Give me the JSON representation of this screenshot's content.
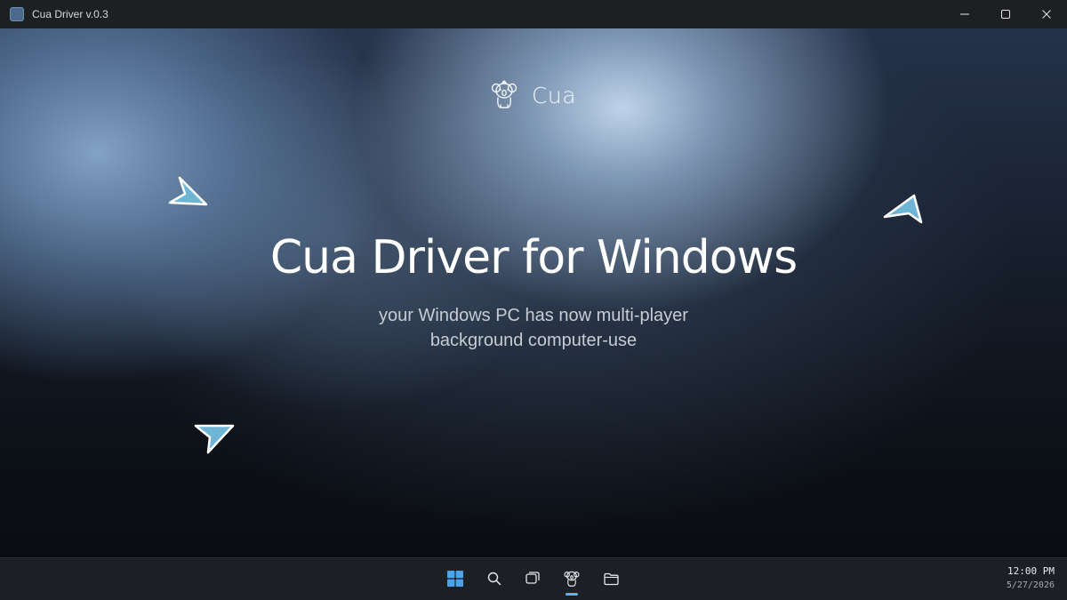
{
  "window": {
    "title": "Cua Driver v.0.3",
    "controls": [
      "minimize-icon",
      "maximize-icon",
      "close-icon"
    ]
  },
  "hero": {
    "brand": "Cua",
    "brand_icon": "koala-logo",
    "headline": "Cua Driver for Windows",
    "subtitle_line1": "your Windows PC has now multi-player",
    "subtitle_line2": "background computer-use"
  },
  "cursors": [
    {
      "icon": "cursor-arrow-icon",
      "color": "#6fb6d6"
    },
    {
      "icon": "cursor-arrow-icon",
      "color": "#6fb6d6"
    },
    {
      "icon": "cursor-arrow-icon",
      "color": "#6fb6d6"
    }
  ],
  "taskbar": {
    "items": [
      "start-icon",
      "search-icon",
      "task-view-icon",
      "cua-app-icon",
      "file-explorer-icon"
    ],
    "active_item": "cua-app-icon",
    "clock_time": "12:00 PM",
    "clock_date": "5/27/2026"
  },
  "colors": {
    "accent": "#5fb2f2",
    "start": "#4aa3ec",
    "cursor_fill": "#6fb6d6"
  }
}
